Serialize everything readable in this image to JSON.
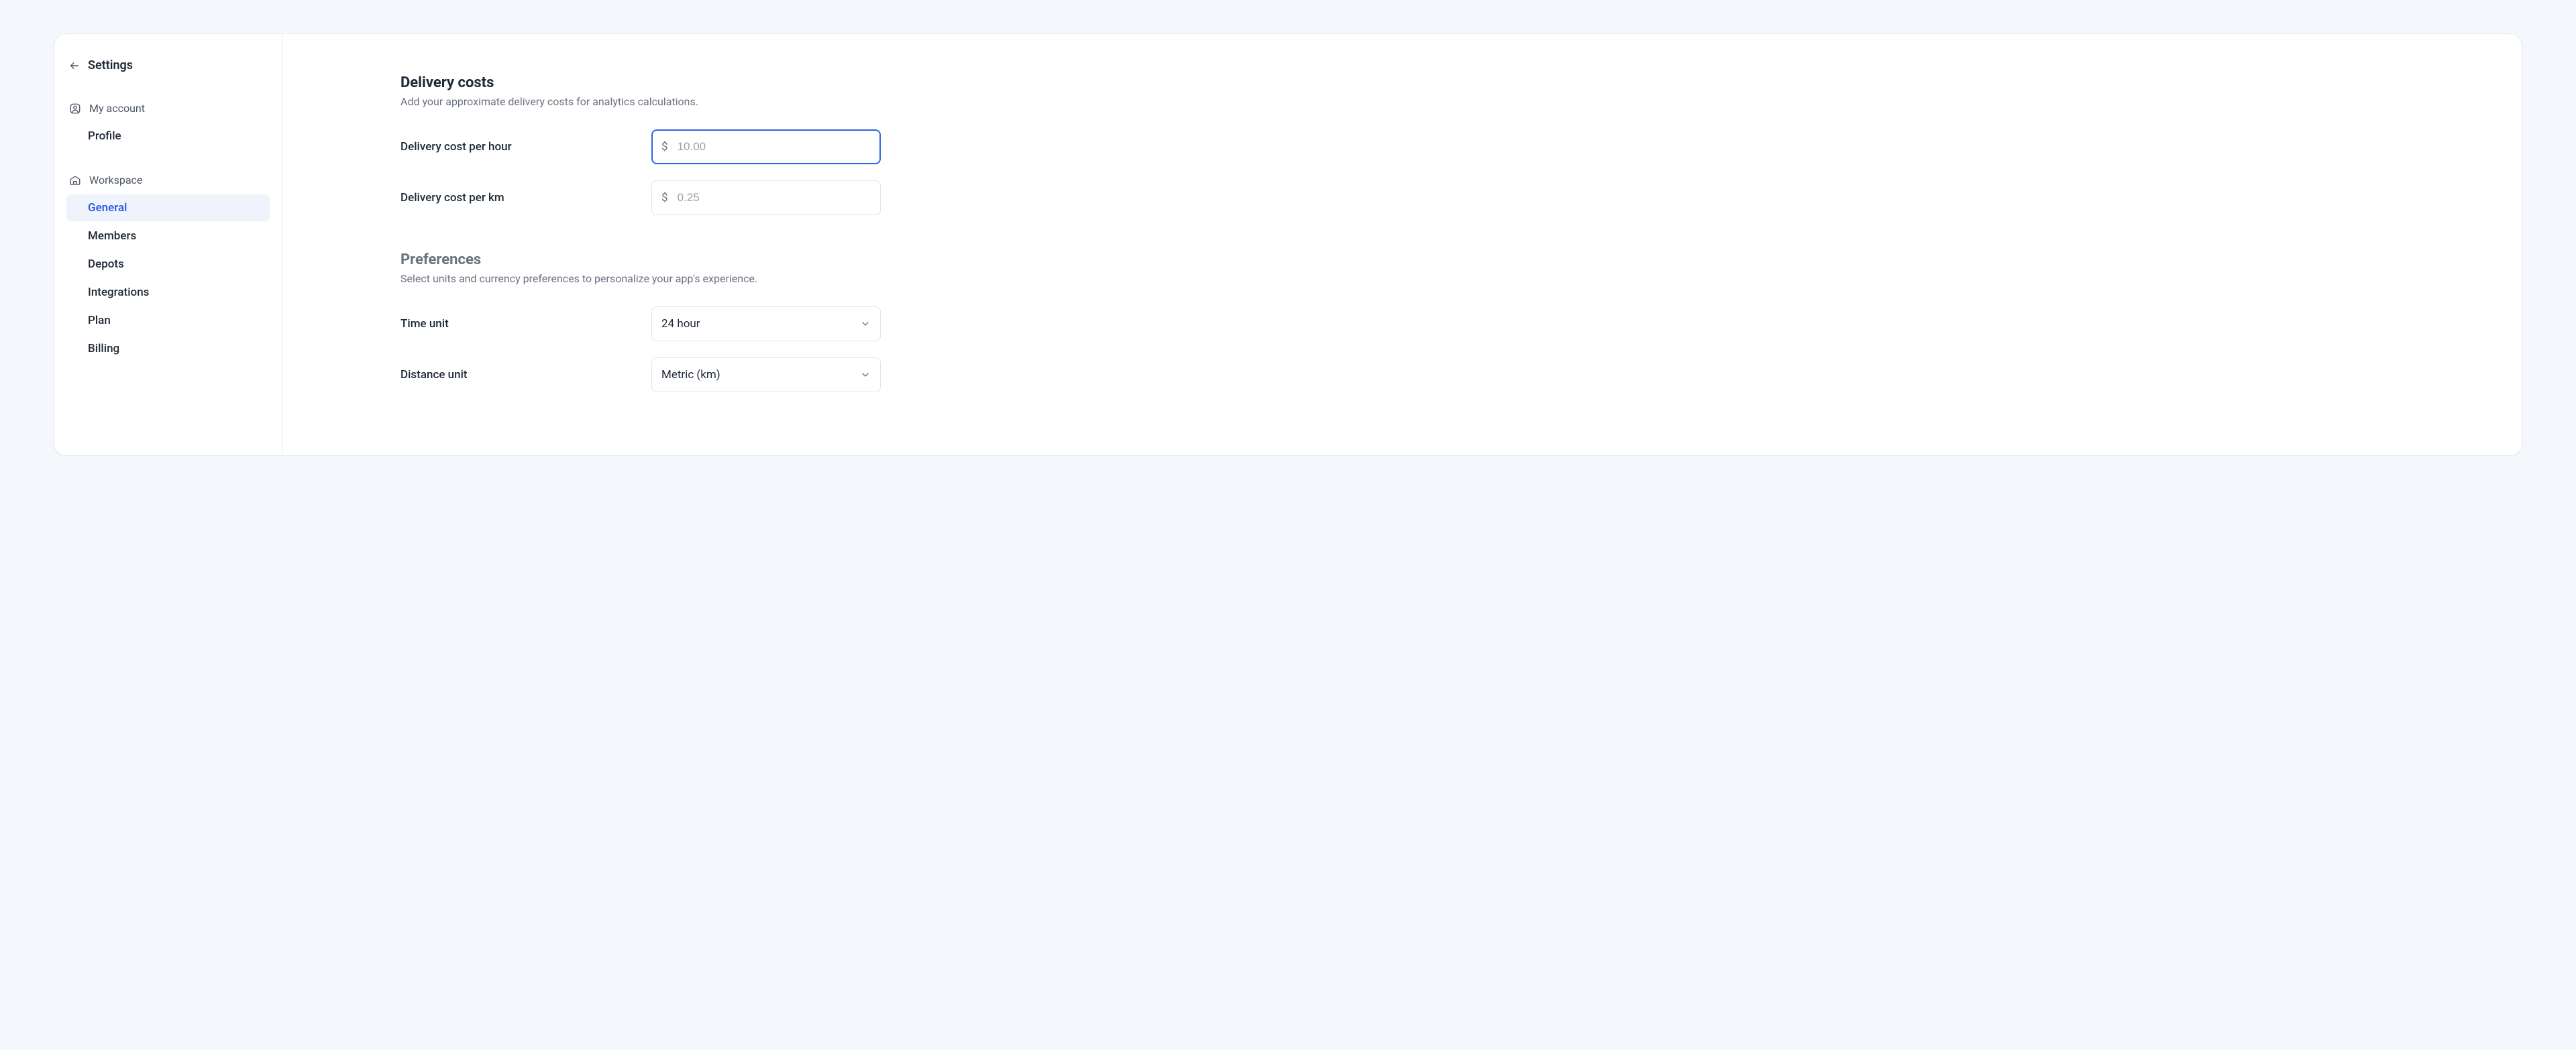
{
  "sidebar": {
    "title": "Settings",
    "sections": [
      {
        "label": "My account",
        "items": [
          {
            "label": "Profile",
            "active": false
          }
        ]
      },
      {
        "label": "Workspace",
        "items": [
          {
            "label": "General",
            "active": true
          },
          {
            "label": "Members",
            "active": false
          },
          {
            "label": "Depots",
            "active": false
          },
          {
            "label": "Integrations",
            "active": false
          },
          {
            "label": "Plan",
            "active": false
          },
          {
            "label": "Billing",
            "active": false
          }
        ]
      }
    ]
  },
  "main": {
    "delivery_costs": {
      "title": "Delivery costs",
      "subtitle": "Add your approximate delivery costs for analytics calculations.",
      "per_hour": {
        "label": "Delivery cost per hour",
        "prefix": "$",
        "placeholder": "10.00",
        "value": ""
      },
      "per_km": {
        "label": "Delivery cost per km",
        "prefix": "$",
        "placeholder": "0.25",
        "value": ""
      }
    },
    "preferences": {
      "title": "Preferences",
      "subtitle": "Select units and currency preferences to personalize your app's experience.",
      "time_unit": {
        "label": "Time unit",
        "value": "24 hour"
      },
      "distance_unit": {
        "label": "Distance unit",
        "value": "Metric (km)"
      }
    }
  }
}
